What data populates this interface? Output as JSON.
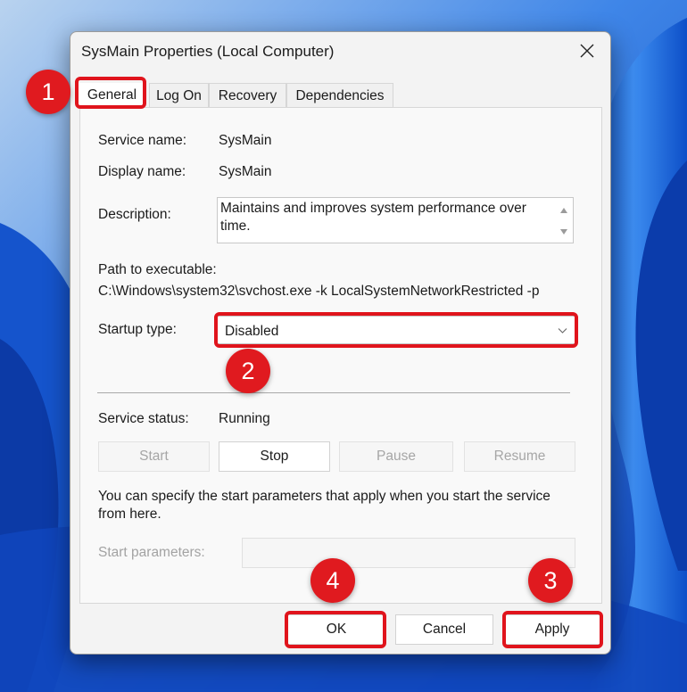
{
  "dialog": {
    "title": "SysMain Properties (Local Computer)"
  },
  "tabs": [
    {
      "label": "General"
    },
    {
      "label": "Log On"
    },
    {
      "label": "Recovery"
    },
    {
      "label": "Dependencies"
    }
  ],
  "general": {
    "service_name_label": "Service name:",
    "service_name_value": "SysMain",
    "display_name_label": "Display name:",
    "display_name_value": "SysMain",
    "description_label": "Description:",
    "description_value": "Maintains and improves system performance over time.",
    "path_label": "Path to executable:",
    "path_value": "C:\\Windows\\system32\\svchost.exe -k LocalSystemNetworkRestricted -p",
    "startup_type_label": "Startup type:",
    "startup_type_value": "Disabled",
    "service_status_label": "Service status:",
    "service_status_value": "Running",
    "control_buttons": [
      "Start",
      "Stop",
      "Pause",
      "Resume"
    ],
    "hint_text": "You can specify the start parameters that apply when you start the service from here.",
    "start_params_label": "Start parameters:",
    "start_params_value": ""
  },
  "footer": {
    "ok": "OK",
    "cancel": "Cancel",
    "apply": "Apply"
  },
  "annotations": [
    "1",
    "2",
    "3",
    "4"
  ],
  "colors": {
    "annotation_red": "#e01a1f",
    "wallpaper_blue": "#2a6fd6",
    "dialog_bg": "#f3f3f3"
  }
}
